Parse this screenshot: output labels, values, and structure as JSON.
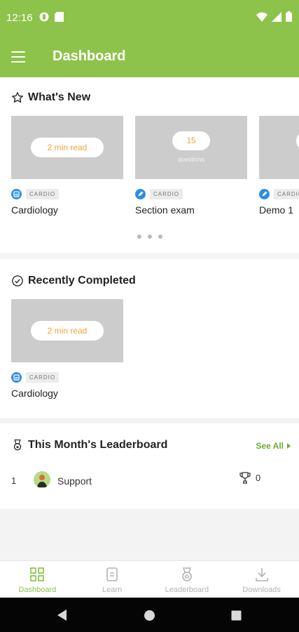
{
  "status_bar": {
    "time": "12:16",
    "icons": [
      "camera-status-icon",
      "sd-card-icon",
      "wifi-icon",
      "signal-icon",
      "battery-icon"
    ]
  },
  "app_bar": {
    "title": "Dashboard"
  },
  "whats_new": {
    "title": "What's New",
    "cards": [
      {
        "badge": "2 min read",
        "tag": "CARDIO",
        "title": "Cardiology"
      },
      {
        "badge": "15",
        "badge_sub": "questions",
        "tag": "CARDIO",
        "title": "Section exam"
      },
      {
        "tag": "CARDIO",
        "title": "Demo 1"
      }
    ],
    "page_dots": 3
  },
  "recently_completed": {
    "title": "Recently Completed",
    "cards": [
      {
        "badge": "2 min read",
        "tag": "CARDIO",
        "title": "Cardiology"
      }
    ]
  },
  "leaderboard": {
    "title": "This Month's Leaderboard",
    "see_all": "See All",
    "rows": [
      {
        "rank": "1",
        "name": "Support",
        "score": "0"
      }
    ]
  },
  "bottom_nav": {
    "items": [
      {
        "label": "Dashboard",
        "icon": "dashboard-icon",
        "active": true
      },
      {
        "label": "Learn",
        "icon": "learn-icon",
        "active": false
      },
      {
        "label": "Leaderboard",
        "icon": "leaderboard-icon",
        "active": false
      },
      {
        "label": "Downloads",
        "icon": "downloads-icon",
        "active": false
      }
    ]
  },
  "colors": {
    "brand_green": "#8dc34a",
    "link_green": "#67ad2f",
    "badge_orange": "#f0a33c",
    "category_blue": "#2d8ee8",
    "placeholder_gray": "#cccccc"
  }
}
